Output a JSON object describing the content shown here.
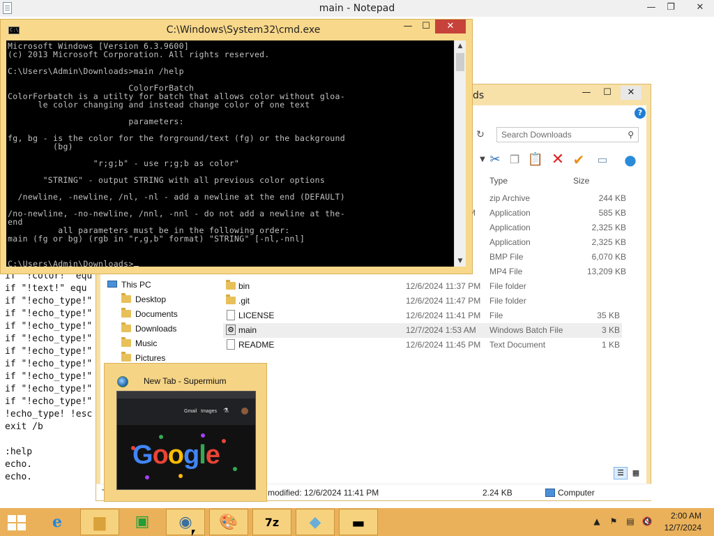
{
  "notepad": {
    "title": "main - Notepad",
    "controls": {
      "minimize": "—",
      "maximize": "❐",
      "close": "✕"
    },
    "lines": [
      "if \"!color!\" equ",
      "if \"!text!\" equ",
      "if \"!echo_type!\"",
      "if \"!echo_type!\"",
      "if \"!echo_type!\"",
      "if \"!echo_type!\"",
      "if \"!echo_type!\"",
      "if \"!echo_type!\"",
      "if \"!echo_type!\"",
      "if \"!echo_type!\"",
      "if \"!echo_type!\"",
      "!echo_type! !esc",
      "exit /b",
      "",
      ":help",
      "echo.",
      "echo."
    ]
  },
  "cmd": {
    "title": "C:\\Windows\\System32\\cmd.exe",
    "controls": {
      "minimize": "—",
      "maximize": "☐",
      "close": "✕"
    },
    "lines": [
      "Microsoft Windows [Version 6.3.9600]",
      "(c) 2013 Microsoft Corporation. All rights reserved.",
      "",
      "C:\\Users\\Admin\\Downloads>main /help",
      "",
      "                        ColorForBatch",
      "ColorForbatch is a utilty for batch that allows color without gloa-",
      "      le color changing and instead change color of one text",
      "",
      "                        parameters:",
      "",
      "fg, bg - is the color for the forground/text (fg) or the background",
      "         (bg)",
      "",
      "                 \"r;g;b\" - use r;g;b as color\"",
      "",
      "       \"STRING\" - output STRING with all previous color options",
      "",
      "  /newline, -newline, /nl, -nl - add a newline at the end (DEFAULT)",
      "",
      "/no-newline, -no-newline, /nnl, -nnl - do not add a newline at the-",
      "end",
      "          all parameters must be in the following order:",
      "main (fg or bg) (rgb in \"r,g,b\" format) \"STRING\" [-nl,-nnl]",
      "",
      "",
      "C:\\Users\\Admin\\Downloads>"
    ]
  },
  "explorer": {
    "title_partial": "ds",
    "controls": {
      "minimize": "—",
      "maximize": "☐",
      "close": "✕"
    },
    "help": "?",
    "search_placeholder": "Search Downloads",
    "columns": {
      "type": "Type",
      "size": "Size"
    },
    "partial_rows": [
      {
        "date_tail": "",
        "type": "zip Archive",
        "size": "244 KB"
      },
      {
        "date_tail": "M",
        "type": "Application",
        "size": "585 KB"
      },
      {
        "date_tail": "",
        "type": "Application",
        "size": "2,325 KB"
      },
      {
        "date_tail": "",
        "type": "Application",
        "size": "2,325 KB"
      },
      {
        "date_tail": "",
        "type": "BMP File",
        "size": "6,070 KB"
      },
      {
        "date_tail": "",
        "type": "MP4 File",
        "size": "13,209 KB"
      }
    ],
    "rows": [
      {
        "name": "bin",
        "date": "12/6/2024 11:37 PM",
        "type": "File folder",
        "size": "",
        "icon": "folder-icon"
      },
      {
        "name": ".git",
        "date": "12/6/2024 11:47 PM",
        "type": "File folder",
        "size": "",
        "icon": "folder-icon"
      },
      {
        "name": "LICENSE",
        "date": "12/6/2024 11:41 PM",
        "type": "File",
        "size": "35 KB",
        "icon": "file-icon"
      },
      {
        "name": "main",
        "date": "12/7/2024 1:53 AM",
        "type": "Windows Batch File",
        "size": "3 KB",
        "icon": "batch-file-icon"
      },
      {
        "name": "README",
        "date": "12/6/2024 11:45 PM",
        "type": "Text Document",
        "size": "1 KB",
        "icon": "file-icon"
      }
    ],
    "nav": [
      {
        "label": "This PC",
        "icon": "computer-icon"
      },
      {
        "label": "Desktop",
        "icon": "folder-icon"
      },
      {
        "label": "Documents",
        "icon": "folder-icon"
      },
      {
        "label": "Downloads",
        "icon": "folder-icon"
      },
      {
        "label": "Music",
        "icon": "folder-icon"
      },
      {
        "label": "Pictures",
        "icon": "folder-icon"
      }
    ],
    "status": {
      "modified": "modified: 12/6/2024 11:41 PM",
      "size": "2.24 KB",
      "location": "Computer",
      "t": "T"
    }
  },
  "preview": {
    "title": "New Tab - Supermium",
    "links": {
      "gmail": "Gmail",
      "images": "Images"
    },
    "logo": "Google"
  },
  "taskbar": {
    "clock_time": "2:00 AM",
    "clock_date": "12/7/2024",
    "apps": [
      {
        "name": "internet-explorer-icon"
      },
      {
        "name": "file-explorer-icon"
      },
      {
        "name": "store-icon"
      },
      {
        "name": "supermium-icon"
      },
      {
        "name": "paint-icon"
      },
      {
        "name": "7zip-icon",
        "label": "7z"
      },
      {
        "name": "app-icon"
      },
      {
        "name": "cmd-icon"
      }
    ]
  },
  "colors": {
    "accent": "#eab15a",
    "window_frame": "#f8d88a",
    "console_bg": "#000000",
    "console_text": "#c0c0c0"
  }
}
